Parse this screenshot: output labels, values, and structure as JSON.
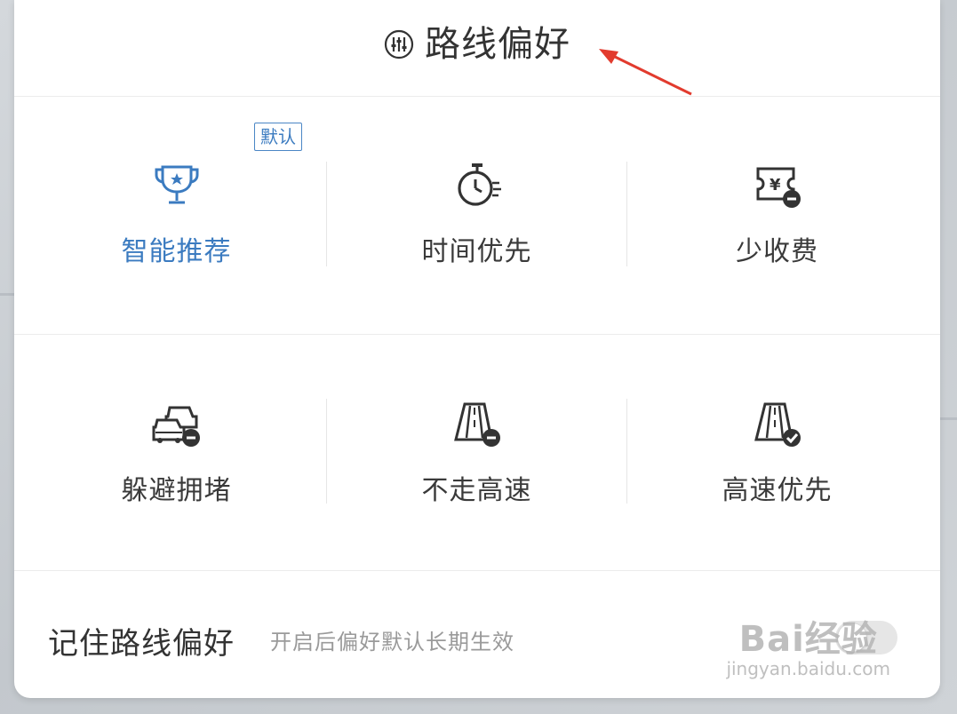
{
  "header": {
    "title": "路线偏好",
    "icon": "sliders-icon"
  },
  "default_badge": "默认",
  "options": [
    {
      "label": "智能推荐",
      "icon": "trophy-icon",
      "active": true
    },
    {
      "label": "时间优先",
      "icon": "stopwatch-icon",
      "active": false
    },
    {
      "label": "少收费",
      "icon": "toll-ticket-icon",
      "active": false
    },
    {
      "label": "躲避拥堵",
      "icon": "traffic-cars-icon",
      "active": false
    },
    {
      "label": "不走高速",
      "icon": "no-highway-icon",
      "active": false
    },
    {
      "label": "高速优先",
      "icon": "highway-check-icon",
      "active": false
    }
  ],
  "footer": {
    "title": "记住路线偏好",
    "description": "开启后偏好默认长期生效",
    "toggle_on": false
  },
  "watermark": {
    "main": "Bai经验",
    "sub": "jingyan.baidu.com"
  },
  "colors": {
    "accent": "#3b7bc0",
    "annotation_arrow": "#e23b2e"
  }
}
